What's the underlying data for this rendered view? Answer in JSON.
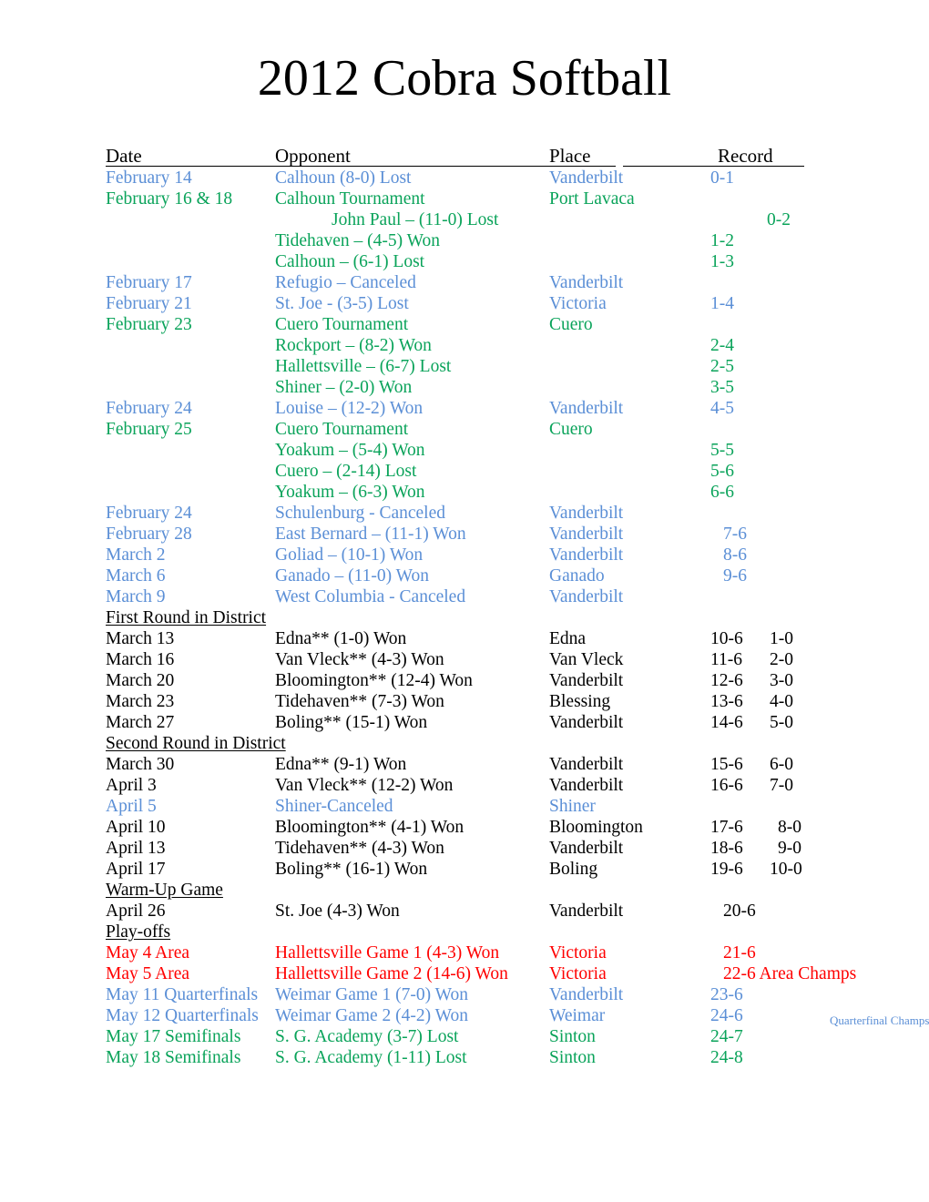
{
  "document": {
    "title": "2012 Cobra Softball"
  },
  "table": {
    "headers": {
      "date": "Date",
      "opponent": "Opponent",
      "place": "Place",
      "record": "Record"
    }
  },
  "sections": [
    {
      "id": "preseason",
      "heading": null,
      "rows": [
        {
          "color": "blue",
          "indent": 0,
          "date": "February 14",
          "opponent": "Calhoun  (8-0) Lost",
          "place": "Vanderbilt",
          "record": "0-1",
          "record2": ""
        },
        {
          "color": "green",
          "indent": 0,
          "date": "February 16 & 18",
          "opponent": "Calhoun Tournament",
          "place": "Port Lavaca",
          "record": "",
          "record2": ""
        },
        {
          "color": "green",
          "indent": 2,
          "date": "",
          "opponent": "John Paul – (11-0) Lost",
          "place": "",
          "record": "0-2",
          "record2": "",
          "record_shift": true
        },
        {
          "color": "green",
          "indent": 1,
          "date": "",
          "opponent": "Tidehaven – (4-5) Won",
          "place": "",
          "record": "1-2",
          "record2": ""
        },
        {
          "color": "green",
          "indent": 1,
          "date": "",
          "opponent": "Calhoun – (6-1) Lost",
          "place": "",
          "record": "1-3",
          "record2": ""
        },
        {
          "color": "blue",
          "indent": 0,
          "date": "February 17",
          "opponent": "Refugio – Canceled",
          "place": "Vanderbilt",
          "record": "",
          "record2": ""
        },
        {
          "color": "blue",
          "indent": 0,
          "date": "February 21",
          "opponent": "St. Joe - (3-5) Lost",
          "place": "Victoria",
          "record": "1-4",
          "record2": ""
        },
        {
          "color": "green",
          "indent": 0,
          "date": "February 23",
          "opponent": "Cuero Tournament",
          "place": "Cuero",
          "record": "",
          "record2": ""
        },
        {
          "color": "green",
          "indent": 1,
          "date": "",
          "opponent": "Rockport – (8-2) Won",
          "place": "",
          "record": "2-4",
          "record2": ""
        },
        {
          "color": "green",
          "indent": 1,
          "date": "",
          "opponent": "Hallettsville – (6-7) Lost",
          "place": "",
          "record": "2-5",
          "record2": ""
        },
        {
          "color": "green",
          "indent": 1,
          "date": "",
          "opponent": "Shiner – (2-0) Won",
          "place": "",
          "record": "3-5",
          "record2": ""
        },
        {
          "color": "blue",
          "indent": 0,
          "date": "February 24",
          "opponent": "Louise – (12-2) Won",
          "place": "Vanderbilt",
          "record": "4-5",
          "record2": ""
        },
        {
          "color": "green",
          "indent": 0,
          "date": "February 25",
          "opponent": "Cuero Tournament",
          "place": "Cuero",
          "record": "",
          "record2": ""
        },
        {
          "color": "green",
          "indent": 1,
          "date": "",
          "opponent": "Yoakum – (5-4) Won",
          "place": "",
          "record": "5-5",
          "record2": ""
        },
        {
          "color": "green",
          "indent": 1,
          "date": "",
          "opponent": "Cuero – (2-14) Lost",
          "place": "",
          "record": "5-6",
          "record2": ""
        },
        {
          "color": "green",
          "indent": 1,
          "date": "",
          "opponent": "Yoakum – (6-3) Won",
          "place": "",
          "record": "6-6",
          "record2": ""
        },
        {
          "color": "blue",
          "indent": 0,
          "date": "February 24",
          "opponent": "Schulenburg - Canceled",
          "place": "Vanderbilt",
          "record": "",
          "record2": ""
        },
        {
          "color": "blue",
          "indent": 0,
          "date": "February 28",
          "opponent": "East Bernard – (11-1) Won",
          "place": "Vanderbilt",
          "record": "7-6",
          "record2": "",
          "record_nudge": true
        },
        {
          "color": "blue",
          "indent": 0,
          "date": "March 2",
          "opponent": "Goliad – (10-1) Won",
          "place": "Vanderbilt",
          "record": "8-6",
          "record2": "",
          "record_nudge": true
        },
        {
          "color": "blue",
          "indent": 0,
          "date": "March 6",
          "opponent": "Ganado – (11-0) Won",
          "place": "Ganado",
          "record": "9-6",
          "record2": "",
          "record_nudge": true
        },
        {
          "color": "blue",
          "indent": 0,
          "date": "March 9",
          "opponent": "West Columbia - Canceled",
          "place": "Vanderbilt",
          "record": "",
          "record2": ""
        }
      ]
    },
    {
      "id": "first-round-district",
      "heading": "First Round in District",
      "rows": [
        {
          "color": "black",
          "indent": 0,
          "date": "March 13",
          "opponent": "Edna** (1-0) Won",
          "place": "Edna",
          "record": "10-6",
          "record2": "1-0"
        },
        {
          "color": "black",
          "indent": 0,
          "date": "March 16",
          "opponent": "Van Vleck** (4-3) Won",
          "place": "Van Vleck",
          "record": "11-6",
          "record2": "2-0"
        },
        {
          "color": "black",
          "indent": 0,
          "date": "March 20",
          "opponent": "Bloomington** (12-4) Won",
          "place": "Vanderbilt",
          "record": "12-6",
          "record2": "3-0"
        },
        {
          "color": "black",
          "indent": 0,
          "date": "March 23",
          "opponent": "Tidehaven** (7-3) Won",
          "place": "Blessing",
          "record": "13-6",
          "record2": "4-0"
        },
        {
          "color": "black",
          "indent": 0,
          "date": "March 27",
          "opponent": "Boling** (15-1) Won",
          "place": "Vanderbilt",
          "record": "14-6",
          "record2": "5-0"
        }
      ]
    },
    {
      "id": "second-round-district",
      "heading": "Second Round in District",
      "rows": [
        {
          "color": "black",
          "indent": 0,
          "date": "March 30",
          "opponent": "Edna** (9-1) Won",
          "place": "Vanderbilt",
          "record": "15-6",
          "record2": "6-0"
        },
        {
          "color": "black",
          "indent": 0,
          "date": "April 3",
          "opponent": "Van Vleck** (12-2) Won",
          "place": "Vanderbilt",
          "record": "16-6",
          "record2": "7-0"
        },
        {
          "color": "blue",
          "indent": 0,
          "date": "April 5",
          "opponent": "Shiner-Canceled",
          "place": "Shiner",
          "record": "",
          "record2": ""
        },
        {
          "color": "black",
          "indent": 0,
          "date": "April 10",
          "opponent": "Bloomington** (4-1) Won",
          "place": "Bloomington",
          "record": "17-6",
          "record2": "8-0",
          "record2_nudge": true
        },
        {
          "color": "black",
          "indent": 0,
          "date": "April 13",
          "opponent": "Tidehaven** (4-3) Won",
          "place": "Vanderbilt",
          "record": "18-6",
          "record2": "9-0",
          "record2_nudge": true
        },
        {
          "color": "black",
          "indent": 0,
          "date": "April 17",
          "opponent": "Boling** (16-1) Won",
          "place": "Boling",
          "record": "19-6",
          "record2": "10-0"
        }
      ]
    },
    {
      "id": "warm-up-game",
      "heading": "Warm-Up Game ",
      "rows": [
        {
          "color": "black",
          "indent": 0,
          "date": "April 26",
          "opponent": "St. Joe (4-3) Won",
          "place": "Vanderbilt",
          "record": "20-6",
          "record2": "",
          "record_nudge": true
        }
      ]
    },
    {
      "id": "play-offs",
      "heading": "Play-offs",
      "rows": [
        {
          "color": "red",
          "indent": 0,
          "date": "May 4  Area",
          "opponent": "Hallettsville Game 1 (4-3) Won",
          "place": "Victoria",
          "record": "21-6",
          "record2": "",
          "record_nudge": true
        },
        {
          "color": "red",
          "indent": 0,
          "date": "May 5  Area",
          "opponent": "Hallettsville Game 2 (14-6) Won",
          "place": "Victoria",
          "record": "22-6 Area Champs",
          "record2": "",
          "record_nudge": true
        },
        {
          "color": "blue",
          "indent": 0,
          "date": "May 11 Quarterfinals",
          "opponent": "Weimar Game 1 (7-0) Won",
          "place": "Vanderbilt",
          "record": "23-6",
          "record2": ""
        },
        {
          "color": "blue",
          "indent": 0,
          "date": "May 12 Quarterfinals",
          "opponent": "Weimar Game 2 (4-2) Won",
          "place": "Weimar",
          "record": "24-6",
          "record2": "",
          "note": "Quarterfinal Champs"
        },
        {
          "color": "green",
          "indent": 0,
          "date": "May 17 Semifinals",
          "opponent": "S. G. Academy (3-7) Lost",
          "place": "Sinton",
          "record": "24-7",
          "record2": ""
        },
        {
          "color": "green",
          "indent": 0,
          "date": "May 18 Semifinals",
          "opponent": "S. G. Academy (1-11) Lost",
          "place": "Sinton",
          "record": "24-8",
          "record2": ""
        }
      ]
    }
  ],
  "colors": {
    "blue": "#5b8fd6",
    "green": "#0aa35a",
    "red": "#ff0000",
    "black": "#000000"
  }
}
